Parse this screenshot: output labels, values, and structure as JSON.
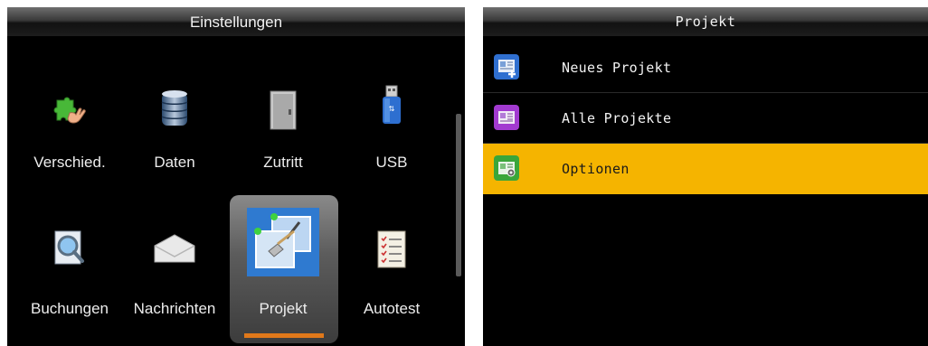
{
  "settings_screen": {
    "title": "Einstellungen",
    "tiles": [
      {
        "label": "Verschied.",
        "icon": "puzzle-hand-icon"
      },
      {
        "label": "Daten",
        "icon": "database-icon"
      },
      {
        "label": "Zutritt",
        "icon": "door-icon"
      },
      {
        "label": "USB",
        "icon": "usb-stick-icon"
      },
      {
        "label": "Buchungen",
        "icon": "magnifier-document-icon"
      },
      {
        "label": "Nachrichten",
        "icon": "envelope-icon"
      },
      {
        "label": "Projekt",
        "icon": "project-tools-icon",
        "selected": true
      },
      {
        "label": "Autotest",
        "icon": "checklist-icon"
      }
    ]
  },
  "project_screen": {
    "title": "Projekt",
    "items": [
      {
        "label": "Neues Projekt",
        "icon": "new-project-icon",
        "icon_color": "#2f6fd0"
      },
      {
        "label": "Alle Projekte",
        "icon": "all-projects-icon",
        "icon_color": "#a23ad0"
      },
      {
        "label": "Optionen",
        "icon": "options-icon",
        "icon_color": "#3aa63a",
        "selected": true
      }
    ],
    "highlight_color": "#f5b400"
  }
}
